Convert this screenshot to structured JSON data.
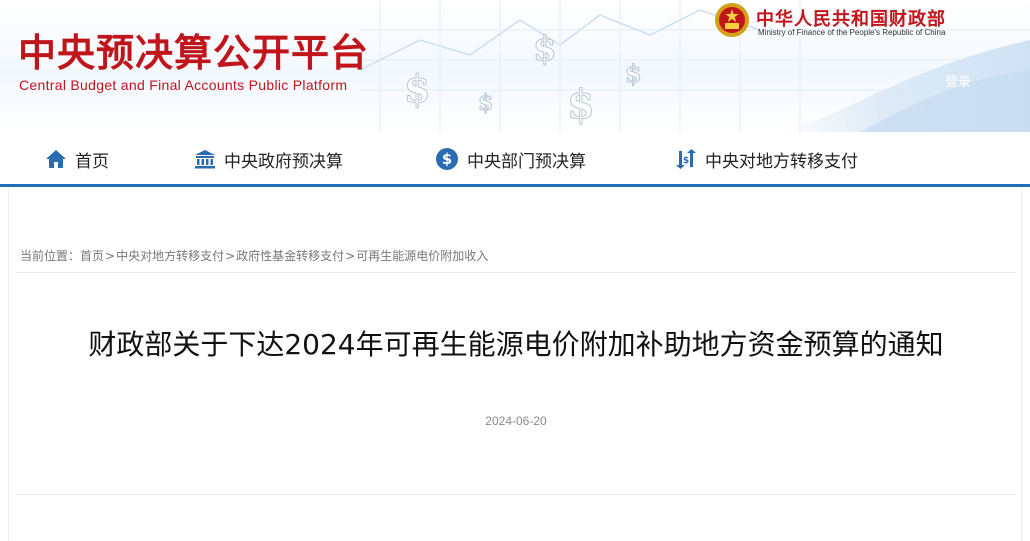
{
  "header": {
    "site_title": "中央预决算公开平台",
    "site_subtitle": "Central Budget and Final Accounts Public Platform",
    "ministry_name": "中华人民共和国财政部",
    "ministry_name_en": "Ministry of Finance of the People's Republic of China",
    "login_label": "登录"
  },
  "nav": {
    "items": [
      {
        "label": "首页",
        "icon": "home-icon"
      },
      {
        "label": "中央政府预决算",
        "icon": "government-building-icon"
      },
      {
        "label": "中央部门预决算",
        "icon": "dollar-circle-icon"
      },
      {
        "label": "中央对地方转移支付",
        "icon": "transfer-arrows-icon"
      }
    ]
  },
  "breadcrumb": {
    "prefix": "当前位置：",
    "items": [
      "首页",
      "中央对地方转移支付",
      "政府性基金转移支付",
      "可再生能源电价附加收入"
    ],
    "separator": ">"
  },
  "article": {
    "title": "财政部关于下达2024年可再生能源电价附加补助地方资金预算的通知",
    "date": "2024-06-20"
  },
  "colors": {
    "brand_red": "#c0151b",
    "nav_blue": "#1f6fb8",
    "icon_blue": "#2b6cb0"
  }
}
